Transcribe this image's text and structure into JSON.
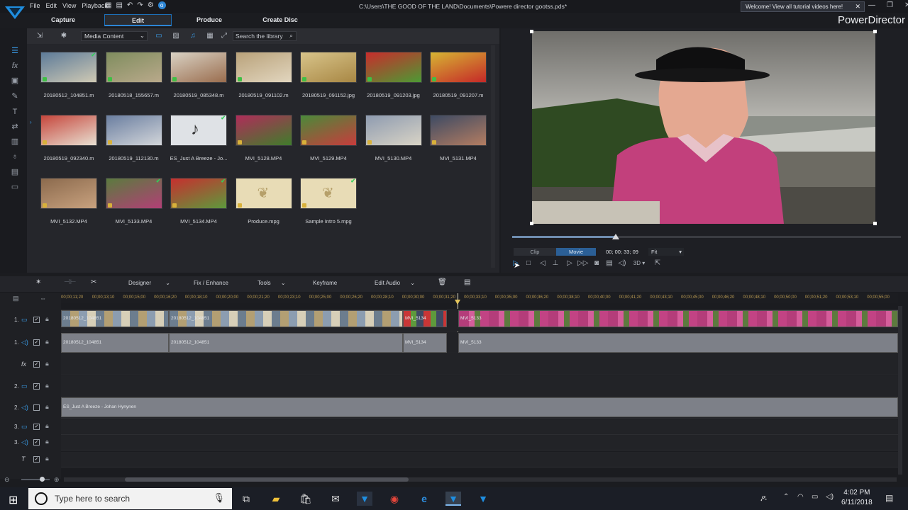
{
  "titlebar": {
    "menu": [
      "File",
      "Edit",
      "View",
      "Playback"
    ],
    "path": "C:\\Users\\THE GOOD OF THE LAND\\Documents\\Powere director gootss.pds*",
    "welcome": "Welcome! View all tutorial videos here!",
    "brand": "PowerDirector"
  },
  "tabs": [
    "Capture",
    "Edit",
    "Produce",
    "Create Disc"
  ],
  "library": {
    "dropdown": "Media Content",
    "search_placeholder": "Search the library",
    "items": [
      {
        "name": "20180512_104851.m",
        "checked": true
      },
      {
        "name": "20180518_155657.m",
        "checked": false
      },
      {
        "name": "20180519_085348.m",
        "checked": false
      },
      {
        "name": "20180519_091102.m",
        "checked": false
      },
      {
        "name": "20180519_091152.jpg",
        "checked": false
      },
      {
        "name": "20180519_091203.jpg",
        "checked": false
      },
      {
        "name": "20180519_091207.m",
        "checked": false
      },
      {
        "name": "20180519_092340.m",
        "checked": false
      },
      {
        "name": "20180519_112130.m",
        "checked": false
      },
      {
        "name": "ES_Just A Breeze - Jo...",
        "checked": true
      },
      {
        "name": "MVI_5128.MP4",
        "checked": false
      },
      {
        "name": "MVI_5129.MP4",
        "checked": false
      },
      {
        "name": "MVI_5130.MP4",
        "checked": false
      },
      {
        "name": "MVI_5131.MP4",
        "checked": false
      },
      {
        "name": "MVI_5132.MP4",
        "checked": false
      },
      {
        "name": "MVI_5133.MP4",
        "checked": true
      },
      {
        "name": "MVI_5134.MP4",
        "checked": true
      },
      {
        "name": "Produce.mpg",
        "checked": false
      },
      {
        "name": "Sample Intro 5.mpg",
        "checked": true
      }
    ]
  },
  "preview": {
    "clip_label": "Clip",
    "movie_label": "Movie",
    "timecode": "00; 00; 33; 09",
    "fit": "Fit",
    "mode_3d": "3D",
    "scrub_progress": 0.265
  },
  "timeline_toolbar": {
    "designer": "Designer",
    "fix_enhance": "Fix / Enhance",
    "tools": "Tools",
    "keyframe": "Keyframe",
    "edit_audio": "Edit Audio"
  },
  "ruler_ticks": [
    "00;00;11;20",
    "00;00;13;10",
    "00;00;15;00",
    "00;00;16;20",
    "00;00;18;10",
    "00;00;20;00",
    "00;00;21;20",
    "00;00;23;10",
    "00;00;25;00",
    "00;00;26;20",
    "00;00;28;10",
    "00;00;30;00",
    "00;00;31;20",
    "00;00;33;10",
    "00;00;35;00",
    "00;00;36;20",
    "00;00;38;10",
    "00;00;40;00",
    "00;00;41;20",
    "00;00;43;10",
    "00;00;45;00",
    "00;00;46;20",
    "00;00;48;10",
    "00;00;50;00",
    "00;00;51;20",
    "00;00;53;10",
    "00;00;55;00"
  ],
  "tracks": [
    {
      "num": "1.",
      "type": "video"
    },
    {
      "num": "1.",
      "type": "audio"
    },
    {
      "num": "",
      "type": "fx"
    },
    {
      "num": "2.",
      "type": "video"
    },
    {
      "num": "2.",
      "type": "audio"
    },
    {
      "num": "3.",
      "type": "video"
    },
    {
      "num": "3.",
      "type": "audio"
    },
    {
      "num": "",
      "type": "title"
    }
  ],
  "clips": {
    "v1": [
      "20180512_104851",
      "20180512_104851",
      "MVI_5134",
      "MVI_5133"
    ],
    "a1": [
      "20180512_104851",
      "20180512_104851",
      "MVI_5134",
      "MVI_5133"
    ],
    "a2": "ES_Just A Breeze - Johan Hynynen"
  },
  "taskbar": {
    "search": "Type here to search",
    "time": "4:02 PM",
    "date": "6/11/2018"
  },
  "colors": {
    "accent": "#2d86d6",
    "timeline_bg": "#222327",
    "audio_wave": "#3d7fbf"
  }
}
